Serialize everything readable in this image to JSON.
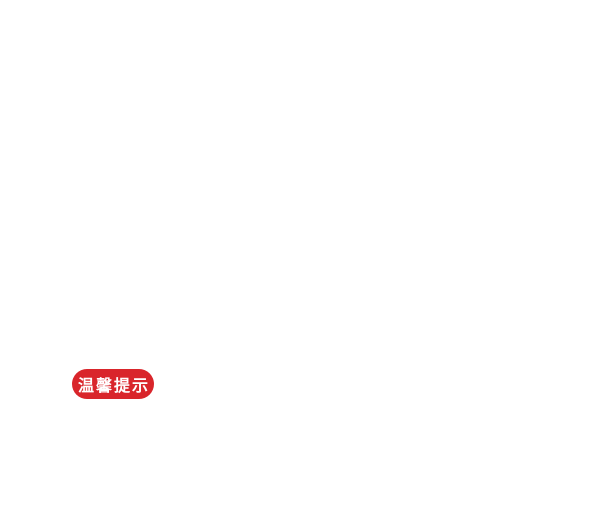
{
  "notice": {
    "label": "温馨提示"
  },
  "colors": {
    "background": "#ffffff",
    "badge": "#d9252b",
    "badge_text": "#ffffff"
  }
}
